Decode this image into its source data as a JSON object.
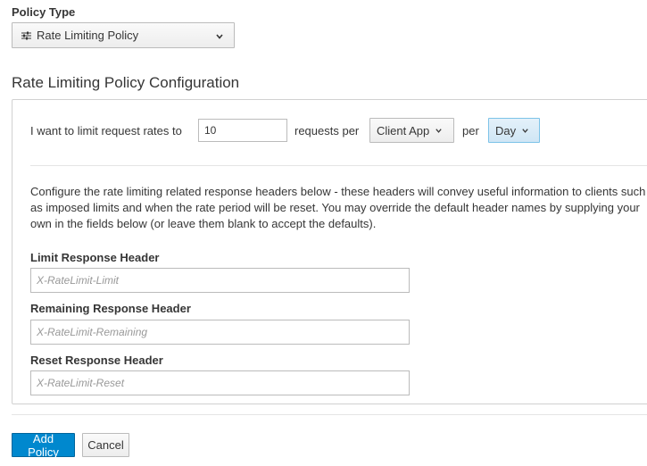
{
  "policy_type": {
    "label": "Policy Type",
    "selected": "Rate Limiting Policy",
    "icon": "sliders-icon"
  },
  "config": {
    "title": "Rate Limiting Policy Configuration",
    "rate_prefix": "I want to limit request rates to",
    "rate_value": "10",
    "requests_per_text": "requests per",
    "granularity_selected": "Client App",
    "per_text": "per",
    "period_selected": "Day",
    "description": "Configure the rate limiting related response headers below - these headers will convey useful information to clients such as imposed limits and when the rate period will be reset. You may override the default header names by supplying your own in the fields below (or leave them blank to accept the defaults).",
    "limit_header": {
      "label": "Limit Response Header",
      "placeholder": "X-RateLimit-Limit",
      "value": ""
    },
    "remaining_header": {
      "label": "Remaining Response Header",
      "placeholder": "X-RateLimit-Remaining",
      "value": ""
    },
    "reset_header": {
      "label": "Reset Response Header",
      "placeholder": "X-RateLimit-Reset",
      "value": ""
    }
  },
  "actions": {
    "add_label": "Add Policy",
    "cancel_label": "Cancel"
  },
  "colors": {
    "primary": "#0088ce",
    "active_dropdown": "#d0e6f5",
    "text": "#363636"
  }
}
